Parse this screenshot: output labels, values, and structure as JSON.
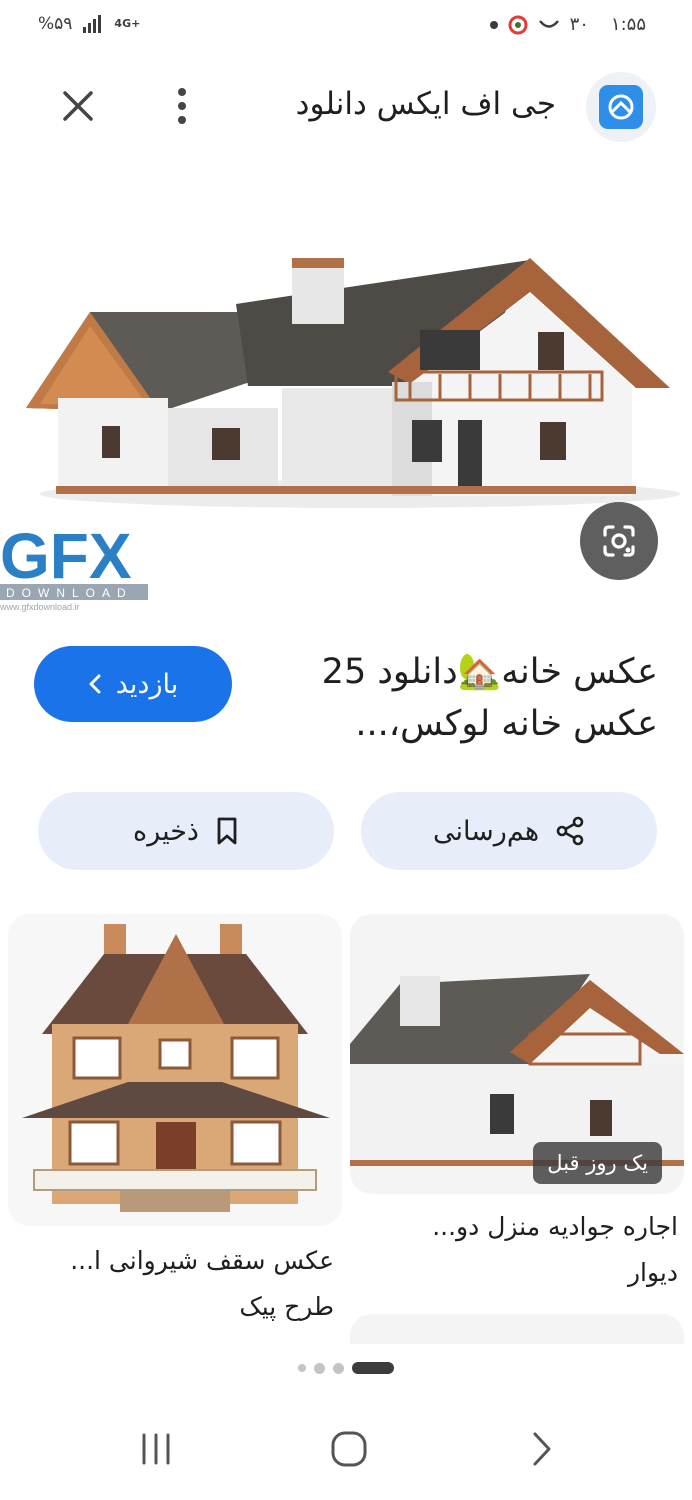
{
  "status_bar": {
    "battery": "%۵۹",
    "network": "4G+",
    "time": "۱:۵۵",
    "temperature": "۳۰"
  },
  "header": {
    "site_name": "جی اف ایکس دانلود",
    "close_icon": "close-icon",
    "menu_icon": "more-vert-icon"
  },
  "hero": {
    "watermark_brand": "GFX",
    "watermark_sub": "DOWNLOAD",
    "watermark_url": "www.gfxdownload.ir",
    "lens_icon": "google-lens-icon"
  },
  "result": {
    "title_line1": "عکس خانه🏡دانلود 25",
    "title_line2": "عکس خانه لوکس،...",
    "visit_label": "بازدید"
  },
  "actions": {
    "share_label": "هم‌رسانی",
    "save_label": "ذخیره"
  },
  "related": [
    {
      "title_line1": "اجاره جوادیه منزل دو...",
      "title_line2": "دیوار",
      "badge": "یک روز قبل"
    },
    {
      "title_line1": "عکس سقف شیروانی ا...",
      "title_line2": "طرح پیک"
    }
  ],
  "colors": {
    "accent": "#1a73e8",
    "chip_bg": "#e8eef9",
    "logo_blue": "#2f8ee8"
  }
}
